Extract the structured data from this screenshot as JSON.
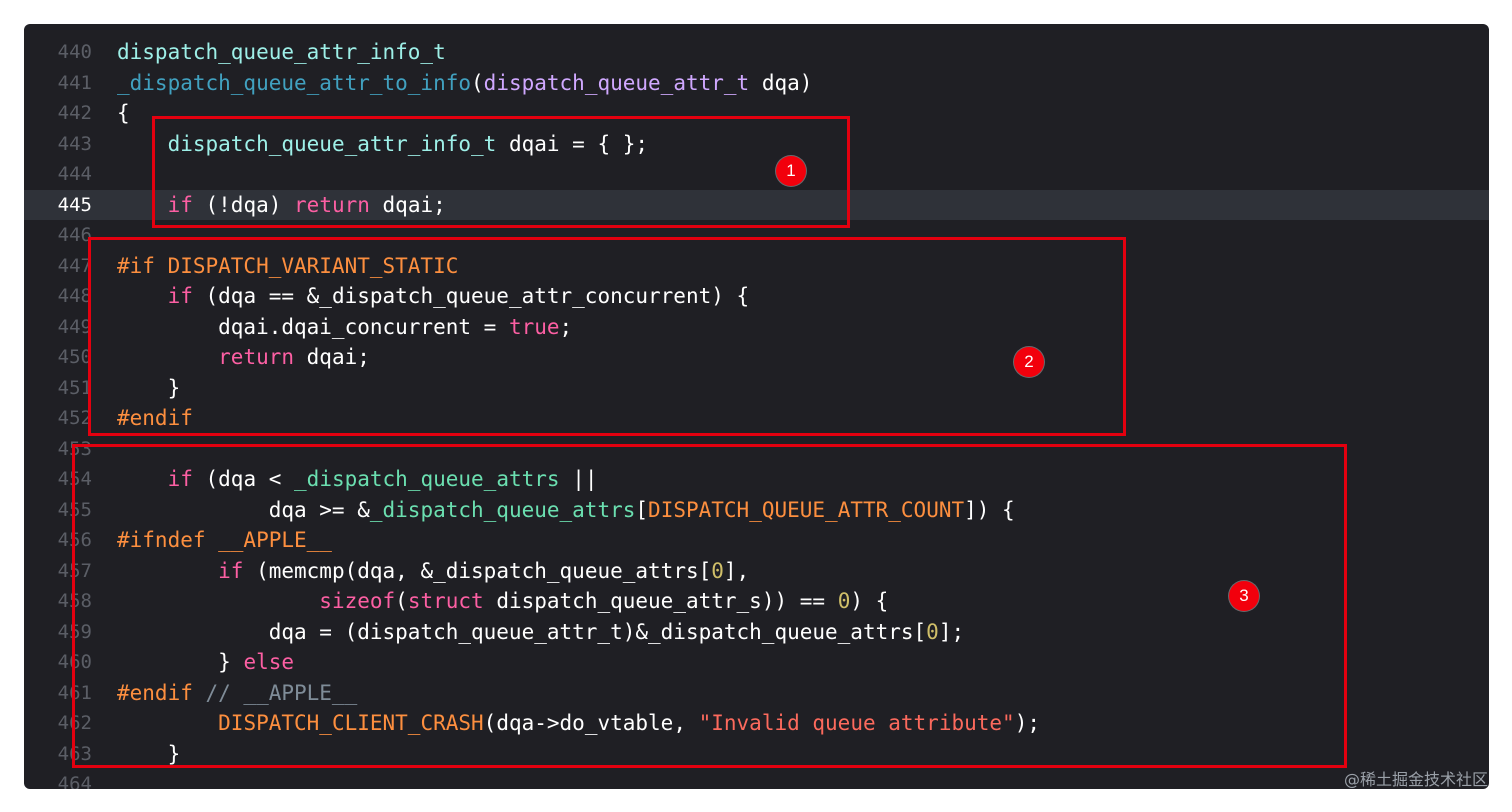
{
  "colors": {
    "plain": "#ffffff",
    "type": "#9ef0e8",
    "func": "#41a1c0",
    "project": "#6bdfb0",
    "keyword": "#fc5fa3",
    "preproc": "#fd8f3f",
    "number": "#d0bf69",
    "string": "#fc6a5d",
    "comment": "#7f8c98",
    "param_type": "#d0a8ff"
  },
  "editor": {
    "current_line": "445",
    "lines": [
      {
        "n": "440",
        "t": [
          [
            "dispatch_queue_attr_info_t",
            "type"
          ]
        ]
      },
      {
        "n": "441",
        "t": [
          [
            "_dispatch_queue_attr_to_info",
            "func"
          ],
          [
            "(",
            "plain"
          ],
          [
            "dispatch_queue_attr_t",
            "param_type"
          ],
          [
            " dqa)",
            "plain"
          ]
        ]
      },
      {
        "n": "442",
        "t": [
          [
            "{",
            "plain"
          ]
        ]
      },
      {
        "n": "443",
        "t": [
          [
            "    ",
            "plain"
          ],
          [
            "dispatch_queue_attr_info_t",
            "type"
          ],
          [
            " dqai = { };",
            "plain"
          ]
        ]
      },
      {
        "n": "444",
        "t": []
      },
      {
        "n": "445",
        "t": [
          [
            "    ",
            "plain"
          ],
          [
            "if",
            "keyword"
          ],
          [
            " (!dqa) ",
            "plain"
          ],
          [
            "return",
            "keyword"
          ],
          [
            " dqai;",
            "plain"
          ]
        ]
      },
      {
        "n": "446",
        "t": []
      },
      {
        "n": "447",
        "t": [
          [
            "#if DISPATCH_VARIANT_STATIC",
            "preproc"
          ]
        ]
      },
      {
        "n": "448",
        "t": [
          [
            "    ",
            "plain"
          ],
          [
            "if",
            "keyword"
          ],
          [
            " (dqa == &_dispatch_queue_attr_concurrent) {",
            "plain"
          ]
        ]
      },
      {
        "n": "449",
        "t": [
          [
            "        dqai.dqai_concurrent = ",
            "plain"
          ],
          [
            "true",
            "keyword"
          ],
          [
            ";",
            "plain"
          ]
        ]
      },
      {
        "n": "450",
        "t": [
          [
            "        ",
            "plain"
          ],
          [
            "return",
            "keyword"
          ],
          [
            " dqai;",
            "plain"
          ]
        ]
      },
      {
        "n": "451",
        "t": [
          [
            "    }",
            "plain"
          ]
        ]
      },
      {
        "n": "452",
        "t": [
          [
            "#endif",
            "preproc"
          ]
        ]
      },
      {
        "n": "453",
        "t": []
      },
      {
        "n": "454",
        "t": [
          [
            "    ",
            "plain"
          ],
          [
            "if",
            "keyword"
          ],
          [
            " (dqa < ",
            "plain"
          ],
          [
            "_dispatch_queue_attrs",
            "project"
          ],
          [
            " ||",
            "plain"
          ]
        ]
      },
      {
        "n": "455",
        "t": [
          [
            "            dqa >= &",
            "plain"
          ],
          [
            "_dispatch_queue_attrs",
            "project"
          ],
          [
            "[",
            "plain"
          ],
          [
            "DISPATCH_QUEUE_ATTR_COUNT",
            "preproc"
          ],
          [
            "]) {",
            "plain"
          ]
        ]
      },
      {
        "n": "456",
        "t": [
          [
            "#ifndef __APPLE__",
            "preproc"
          ]
        ]
      },
      {
        "n": "457",
        "t": [
          [
            "        ",
            "plain"
          ],
          [
            "if",
            "keyword"
          ],
          [
            " (memcmp(dqa, &_dispatch_queue_attrs[",
            "plain"
          ],
          [
            "0",
            "number"
          ],
          [
            "],",
            "plain"
          ]
        ]
      },
      {
        "n": "458",
        "t": [
          [
            "                ",
            "plain"
          ],
          [
            "sizeof",
            "keyword"
          ],
          [
            "(",
            "plain"
          ],
          [
            "struct",
            "keyword"
          ],
          [
            " dispatch_queue_attr_s)) == ",
            "plain"
          ],
          [
            "0",
            "number"
          ],
          [
            ") {",
            "plain"
          ]
        ]
      },
      {
        "n": "459",
        "t": [
          [
            "            dqa = (dispatch_queue_attr_t)&_dispatch_queue_attrs[",
            "plain"
          ],
          [
            "0",
            "number"
          ],
          [
            "];",
            "plain"
          ]
        ]
      },
      {
        "n": "460",
        "t": [
          [
            "        } ",
            "plain"
          ],
          [
            "else",
            "keyword"
          ]
        ]
      },
      {
        "n": "461",
        "t": [
          [
            "#endif",
            "preproc"
          ],
          [
            " // __APPLE__",
            "comment"
          ]
        ]
      },
      {
        "n": "462",
        "t": [
          [
            "        ",
            "plain"
          ],
          [
            "DISPATCH_CLIENT_CRASH",
            "preproc"
          ],
          [
            "(dqa->do_vtable, ",
            "plain"
          ],
          [
            "\"Invalid queue attribute\"",
            "string"
          ],
          [
            ");",
            "plain"
          ]
        ]
      },
      {
        "n": "463",
        "t": [
          [
            "    }",
            "plain"
          ]
        ]
      },
      {
        "n": "464",
        "t": []
      }
    ]
  },
  "annotations": {
    "badge_1": "1",
    "badge_2": "2",
    "badge_3": "3"
  },
  "watermark": "@稀土掘金技术社区"
}
